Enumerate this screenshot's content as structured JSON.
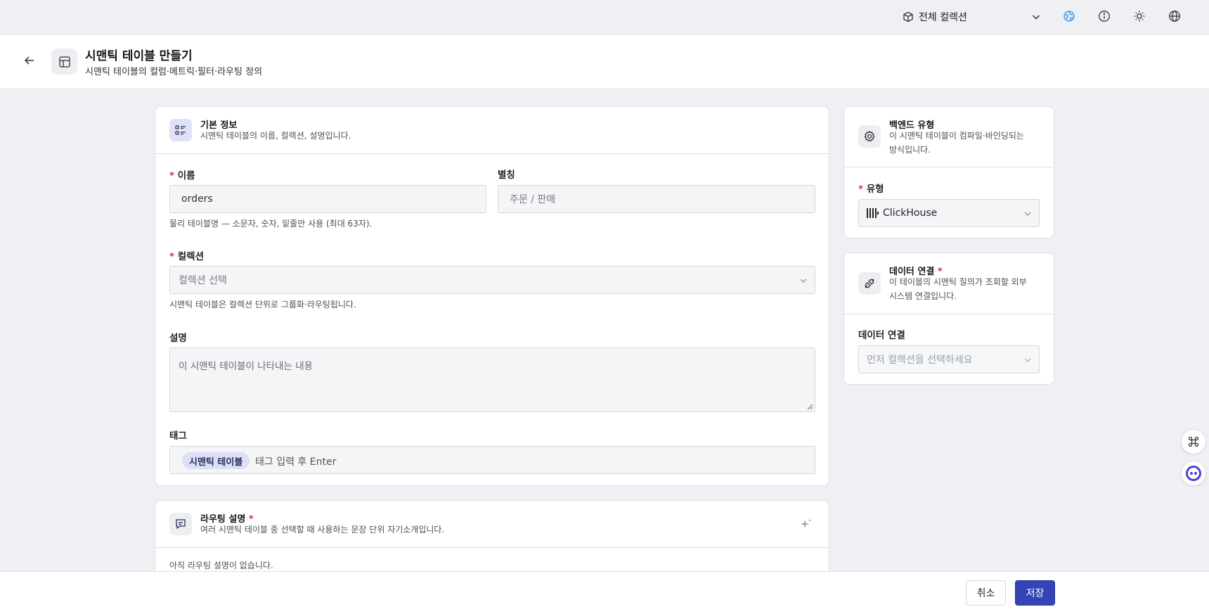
{
  "topbar": {
    "collection_label": "전체 컬렉션"
  },
  "header": {
    "title": "시맨틱 테이블 만들기",
    "subtitle": "시맨틱 테이블의 컬럼·메트릭·필터·라우팅 정의"
  },
  "basic_info": {
    "title": "기본 정보",
    "description": "시맨틱 테이블의 이름, 컬렉션, 설명입니다.",
    "name_label": "이름",
    "name_value": "orders",
    "name_hint": "물리 테이블명 — 소문자, 숫자, 밑줄만 사용 (최대 63자).",
    "alias_label": "별칭",
    "alias_placeholder": "주문 / 판매",
    "collection_label": "컬렉션",
    "collection_placeholder": "컬렉션 선택",
    "collection_hint": "시맨틱 테이블은 컬렉션 단위로 그룹화·라우팅됩니다.",
    "description_label": "설명",
    "description_placeholder": "이 시맨틱 테이블이 나타내는 내용",
    "tags_label": "태그",
    "tags": [
      "시맨틱 테이블"
    ],
    "tags_placeholder": "태그 입력 후 Enter"
  },
  "routing": {
    "title": "라우팅 설명",
    "description": "여러 시맨틱 테이블 중 선택할 때 사용하는 문장 단위 자기소개입니다.",
    "empty_text": "아직 라우팅 설명이 없습니다."
  },
  "backend": {
    "title": "백엔드 유형",
    "description_line1": "이 시맨틱 테이블이 컴파일·바인딩되는",
    "description_line2": "방식입니다.",
    "type_label": "유형",
    "type_value": "ClickHouse"
  },
  "data_connection": {
    "title": "데이터 연결",
    "description_line1": "이 테이블의 시맨틱 질의가 조회할 외부",
    "description_line2": "시스템 연결입니다.",
    "field_label": "데이터 연결",
    "field_placeholder": "먼저 컬렉션을 선택하세요"
  },
  "footer": {
    "cancel_label": "취소",
    "save_label": "저장"
  },
  "colors": {
    "accent": "#3443b5",
    "required": "#d0343b",
    "tag_bg": "#dcdff6"
  }
}
